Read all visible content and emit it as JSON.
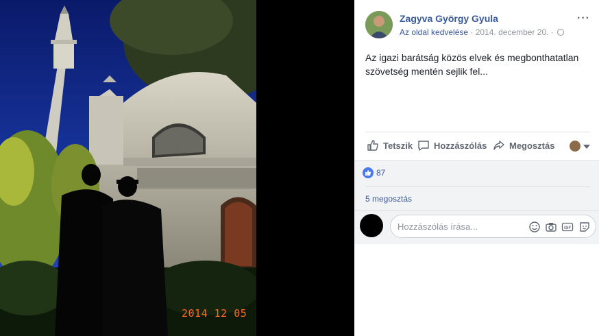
{
  "photo": {
    "date_stamp": "2014 12 05"
  },
  "post": {
    "author": "Zagyva György Gyula",
    "like_page": "Az oldal kedvelése",
    "date_sep": " · 2014. december 20. · ",
    "text": "Az igazi barátság közös elvek és megbonthatatlan szövetség mentén sejlik fel...",
    "more": "···"
  },
  "actions": {
    "like": "Tetszik",
    "comment": "Hozzászólás",
    "share": "Megosztás"
  },
  "stats": {
    "reactions": "87",
    "shares": "5 megosztás"
  },
  "comment_box": {
    "placeholder": "Hozzászólás írása..."
  },
  "icons": [
    "more-icon",
    "globe-icon",
    "like-icon",
    "comment-icon",
    "share-icon",
    "emoji-icon",
    "camera-icon",
    "gif-icon",
    "sticker-icon"
  ],
  "colors": {
    "link": "#385898",
    "meta": "#90949c",
    "action": "#606770",
    "stamp": "#ff6a1a"
  }
}
